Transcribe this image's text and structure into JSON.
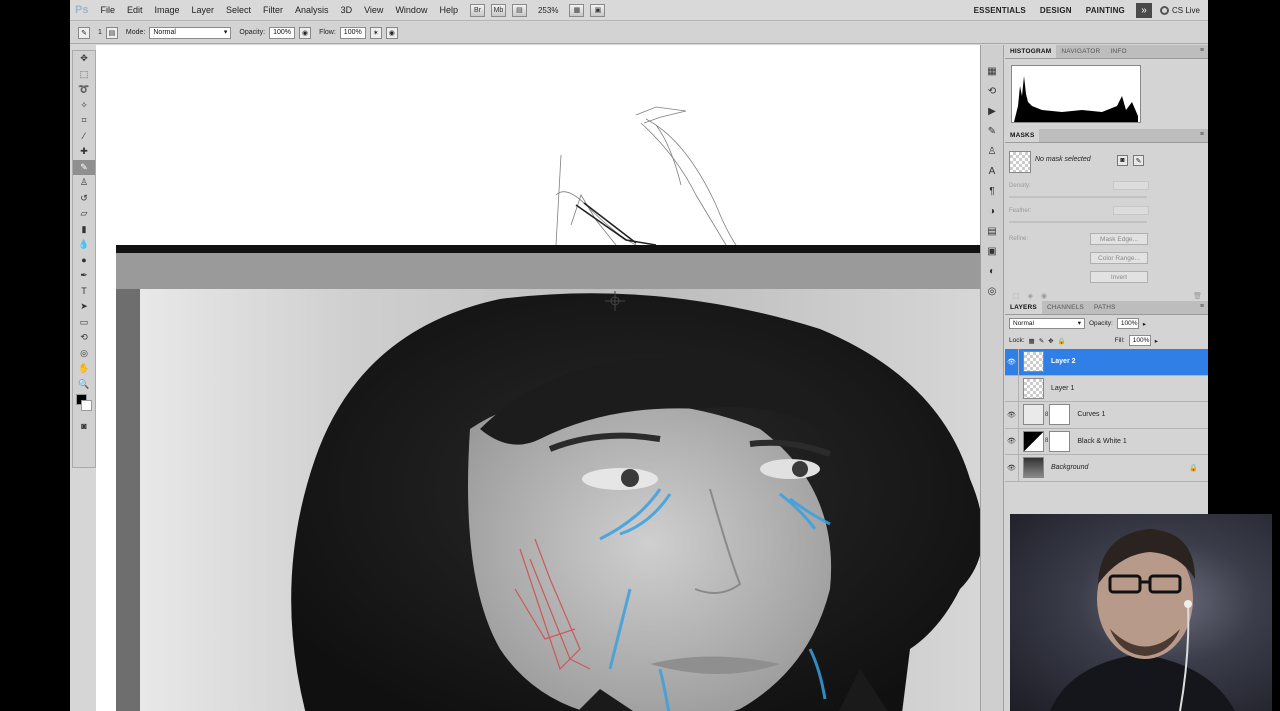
{
  "app": {
    "logo": "Ps",
    "menu": [
      "File",
      "Edit",
      "Image",
      "Layer",
      "Select",
      "Filter",
      "Analysis",
      "3D",
      "View",
      "Window",
      "Help"
    ],
    "zoom": "253%",
    "workspaces": [
      "ESSENTIALS",
      "DESIGN",
      "PAINTING"
    ],
    "more_glyph": "»",
    "cslive": "CS Live"
  },
  "options": {
    "brush_size": "1",
    "mode_label": "Mode:",
    "mode_value": "Normal",
    "opacity_label": "Opacity:",
    "opacity_value": "100%",
    "flow_label": "Flow:",
    "flow_value": "100%"
  },
  "panels": {
    "histogram_tabs": [
      "HISTOGRAM",
      "NAVIGATOR",
      "INFO"
    ],
    "masks_tab": "MASKS",
    "masks": {
      "no_mask": "No mask selected",
      "density": "Density:",
      "feather": "Feather:",
      "refine": "Refine:",
      "mask_edge": "Mask Edge...",
      "color_range": "Color Range...",
      "invert": "Invert"
    },
    "layers_tabs": [
      "LAYERS",
      "CHANNELS",
      "PATHS"
    ],
    "layers": {
      "blend_mode": "Normal",
      "opacity_label": "Opacity:",
      "opacity_value": "100%",
      "lock_label": "Lock:",
      "fill_label": "Fill:",
      "fill_value": "100%",
      "items": [
        {
          "name": "Layer 2"
        },
        {
          "name": "Layer 1"
        },
        {
          "name": "Curves 1"
        },
        {
          "name": "Black & White 1"
        },
        {
          "name": "Background"
        }
      ]
    }
  },
  "colors": {
    "selected_layer": "#2f7fe6",
    "sketch_blue": "#3aa0e0",
    "sketch_red": "#d04a4a"
  }
}
